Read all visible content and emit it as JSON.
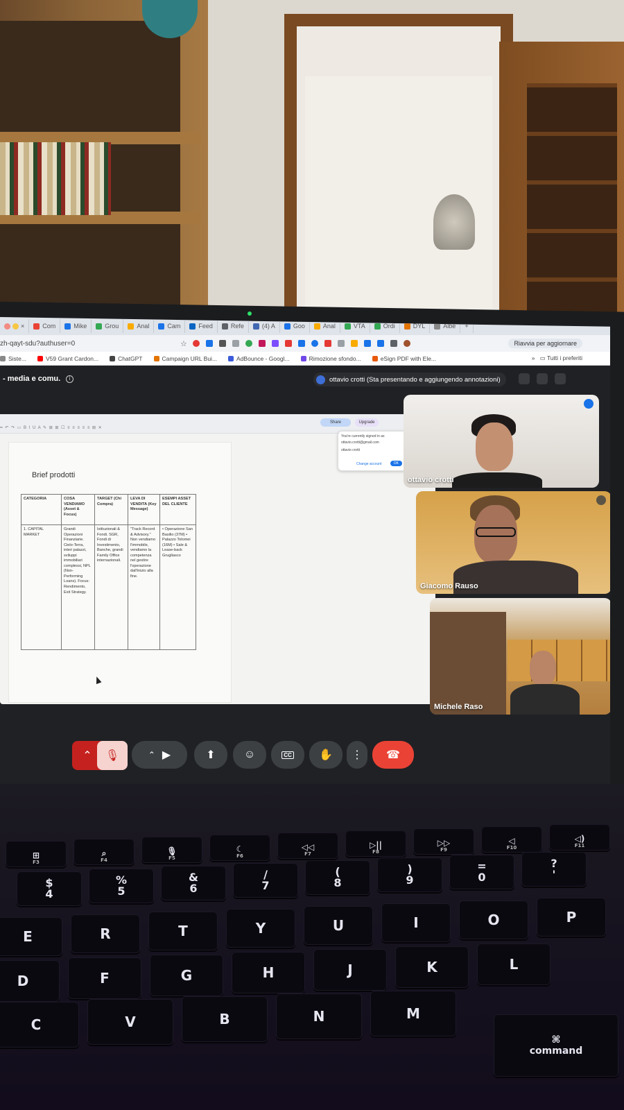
{
  "browser": {
    "tabs": [
      {
        "label": "Com",
        "color": "#ea4335"
      },
      {
        "label": "Mike",
        "color": "#1a73e8"
      },
      {
        "label": "Grou",
        "color": "#34a853"
      },
      {
        "label": "Anal",
        "color": "#f9ab00"
      },
      {
        "label": "Cam",
        "color": "#1a73e8"
      },
      {
        "label": "Feed",
        "color": "#0a66c2"
      },
      {
        "label": "Refe",
        "color": "#5f6368"
      },
      {
        "label": "(4) A",
        "color": "#4267b2"
      },
      {
        "label": "Goo",
        "color": "#1a73e8"
      },
      {
        "label": "Anal",
        "color": "#f9ab00"
      },
      {
        "label": "VTA",
        "color": "#34a853"
      },
      {
        "label": "Ordi",
        "color": "#34a853"
      },
      {
        "label": "DYL",
        "color": "#e37400"
      },
      {
        "label": "Albe",
        "color": "#888888"
      }
    ],
    "new_tab_label": "+",
    "url": "zh-qayt-sdu?authuser=0",
    "reload_label": "Riavvia per aggiornare",
    "bookmarks": [
      {
        "label": "Siste...",
        "color": "#888888"
      },
      {
        "label": "V59 Grant Cardon...",
        "color": "#ff0000"
      },
      {
        "label": "ChatGPT",
        "color": "#444444"
      },
      {
        "label": "Campaign URL Bui...",
        "color": "#e37400"
      },
      {
        "label": "AdBounce - Googl...",
        "color": "#3b5bdb"
      },
      {
        "label": "Rimozione sfondo...",
        "color": "#7048e8"
      },
      {
        "label": "eSign PDF with Ele...",
        "color": "#e8590c"
      }
    ],
    "bookmarks_more": "»",
    "bookmarks_all": "Tutti i preferiti"
  },
  "meet": {
    "title": "- media e comu.",
    "presenting_label": "ottavio crotti (Sta presentando e aggiungendo annotazioni)",
    "participants": [
      {
        "name": "ottavio crotti"
      },
      {
        "name": "Giacomo Rauso"
      },
      {
        "name": "Michele Raso"
      }
    ],
    "controls": {
      "captions_label": "CC",
      "more_label": "⋮"
    }
  },
  "document": {
    "title": "Brief prodotti",
    "share_label": "Share",
    "upgrade_label": "Upgrade",
    "account_popup": {
      "line1": "You're currently signed in as",
      "line2": "ottavio.crotti@gmail.com",
      "account": "ottavio crotti",
      "change": "Change account",
      "ok": "OK"
    },
    "table": {
      "headers": [
        "CATEGORIA",
        "COSA VENDIAMO (Asset & Focus)",
        "TARGET (Chi Compra)",
        "LEVA DI VENDITA (Key Message)",
        "ESEMPI ASSET DEL CLIENTE"
      ],
      "row": [
        "1. CAPITAL MARKET",
        "Grandi Operazioni Finanziarie. Cielo-Terra, interi palazzi, sviluppi immobiliari complessi, NPL (Non-Performing Loans). Focus: Rendimento, Exit Strategy.",
        "Istituzionali & Fondi. SGR, Fondi di Investimento, Banche, grandi Family Office internazionali.",
        "\"Track Record & Advisory.\" Non vendiamo l'immobile, vendiamo la competenza nel gestire l'operazione dall'inizio alla fine.",
        "• Operazione San Basilio (37M) • Palazzo Tolomei (16M) • Sale & Lease-back Grugliasco"
      ]
    }
  },
  "keyboard": {
    "fn_row": [
      {
        "top": "⊞",
        "label": "F3"
      },
      {
        "top": "⌕",
        "label": "F4"
      },
      {
        "top": "🎙",
        "label": "F5"
      },
      {
        "top": "☾",
        "label": "F6"
      },
      {
        "top": "◁◁",
        "label": "F7"
      },
      {
        "top": "▷||",
        "label": "F8"
      },
      {
        "top": "▷▷",
        "label": "F9"
      },
      {
        "top": "◁",
        "label": "F10"
      },
      {
        "top": "◁)",
        "label": "F11"
      }
    ],
    "num_row": [
      {
        "top": "$",
        "label": "4"
      },
      {
        "top": "%",
        "label": "5"
      },
      {
        "top": "&",
        "label": "6"
      },
      {
        "top": "/",
        "label": "7"
      },
      {
        "top": "(",
        "label": "8"
      },
      {
        "top": ")",
        "label": "9"
      },
      {
        "top": "=",
        "label": "0"
      },
      {
        "top": "?",
        "label": "'"
      }
    ],
    "row1": [
      "E",
      "R",
      "T",
      "Y",
      "U",
      "I",
      "O",
      "P"
    ],
    "row2": [
      "D",
      "F",
      "G",
      "H",
      "J",
      "K",
      "L"
    ],
    "row3": [
      "C",
      "V",
      "B",
      "N",
      "M"
    ],
    "command_label": "command",
    "command_symbol": "⌘"
  }
}
